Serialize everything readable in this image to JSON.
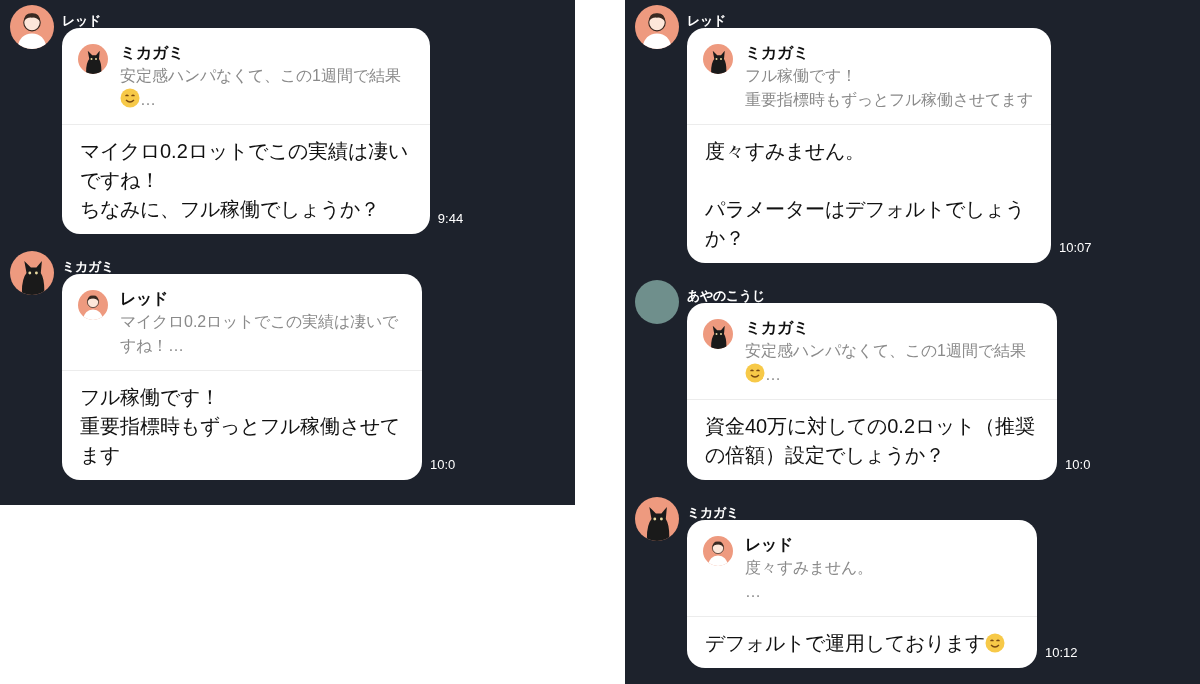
{
  "panels": [
    {
      "messages": [
        {
          "sender": "レッド",
          "avatar": {
            "kind": "person"
          },
          "quote": {
            "sender": "ミカガミ",
            "avatar": {
              "kind": "cat"
            },
            "lines": [
              {
                "kind": "plain",
                "text": "安定感ハンパなくて、この1週間で結果"
              },
              {
                "kind": "emoji_first",
                "text": "…"
              }
            ]
          },
          "lines": [
            {
              "kind": "plain",
              "text": "マイクロ0.2ロットでこの実績は凄い"
            },
            {
              "kind": "plain",
              "text": "ですね！"
            },
            {
              "kind": "plain",
              "text": "ちなみに、フル稼働でしょうか？"
            }
          ],
          "time": "9:44"
        },
        {
          "sender": "ミカガミ",
          "avatar": {
            "kind": "cat"
          },
          "quote": {
            "sender": "レッド",
            "avatar": {
              "kind": "person"
            },
            "lines": [
              {
                "kind": "plain",
                "text": "マイクロ0.2ロットでこの実績は凄いで"
              },
              {
                "kind": "plain",
                "text": "すね！…"
              }
            ]
          },
          "lines": [
            {
              "kind": "plain",
              "text": "フル稼働です！"
            },
            {
              "kind": "plain",
              "text": "重要指標時もずっとフル稼働させて"
            },
            {
              "kind": "plain",
              "text": "ます"
            }
          ],
          "time": "10:0"
        }
      ]
    },
    {
      "messages": [
        {
          "sender": "レッド",
          "avatar": {
            "kind": "person"
          },
          "quote": {
            "sender": "ミカガミ",
            "avatar": {
              "kind": "cat"
            },
            "lines": [
              {
                "kind": "plain",
                "text": "フル稼働です！"
              },
              {
                "kind": "plain",
                "text": "重要指標時もずっとフル稼働させてます"
              }
            ]
          },
          "lines": [
            {
              "kind": "plain",
              "text": "度々すみません。"
            },
            {
              "kind": "paragraph",
              "text": "パラメーターはデフォルトでしょう"
            },
            {
              "kind": "plain",
              "text": "か？"
            }
          ],
          "time": "10:07"
        },
        {
          "sender": "あやのこうじ",
          "avatar": {
            "kind": "photo"
          },
          "quote": {
            "sender": "ミカガミ",
            "avatar": {
              "kind": "cat"
            },
            "lines": [
              {
                "kind": "plain",
                "text": "安定感ハンパなくて、この1週間で結果"
              },
              {
                "kind": "emoji_first",
                "text": "…"
              }
            ]
          },
          "lines": [
            {
              "kind": "plain",
              "text": "資金40万に対しての0.2ロット（推奨"
            },
            {
              "kind": "plain",
              "text": "の倍額）設定でしょうか？"
            }
          ],
          "time": "10:0"
        },
        {
          "sender": "ミカガミ",
          "avatar": {
            "kind": "cat"
          },
          "quote": {
            "sender": "レッド",
            "avatar": {
              "kind": "person"
            },
            "lines": [
              {
                "kind": "plain",
                "text": "度々すみません。"
              },
              {
                "kind": "plain",
                "text": "…"
              }
            ]
          },
          "lines": [
            {
              "kind": "emoji_last",
              "text": "デフォルトで運用しております"
            }
          ],
          "time": "10:12"
        }
      ]
    }
  ]
}
